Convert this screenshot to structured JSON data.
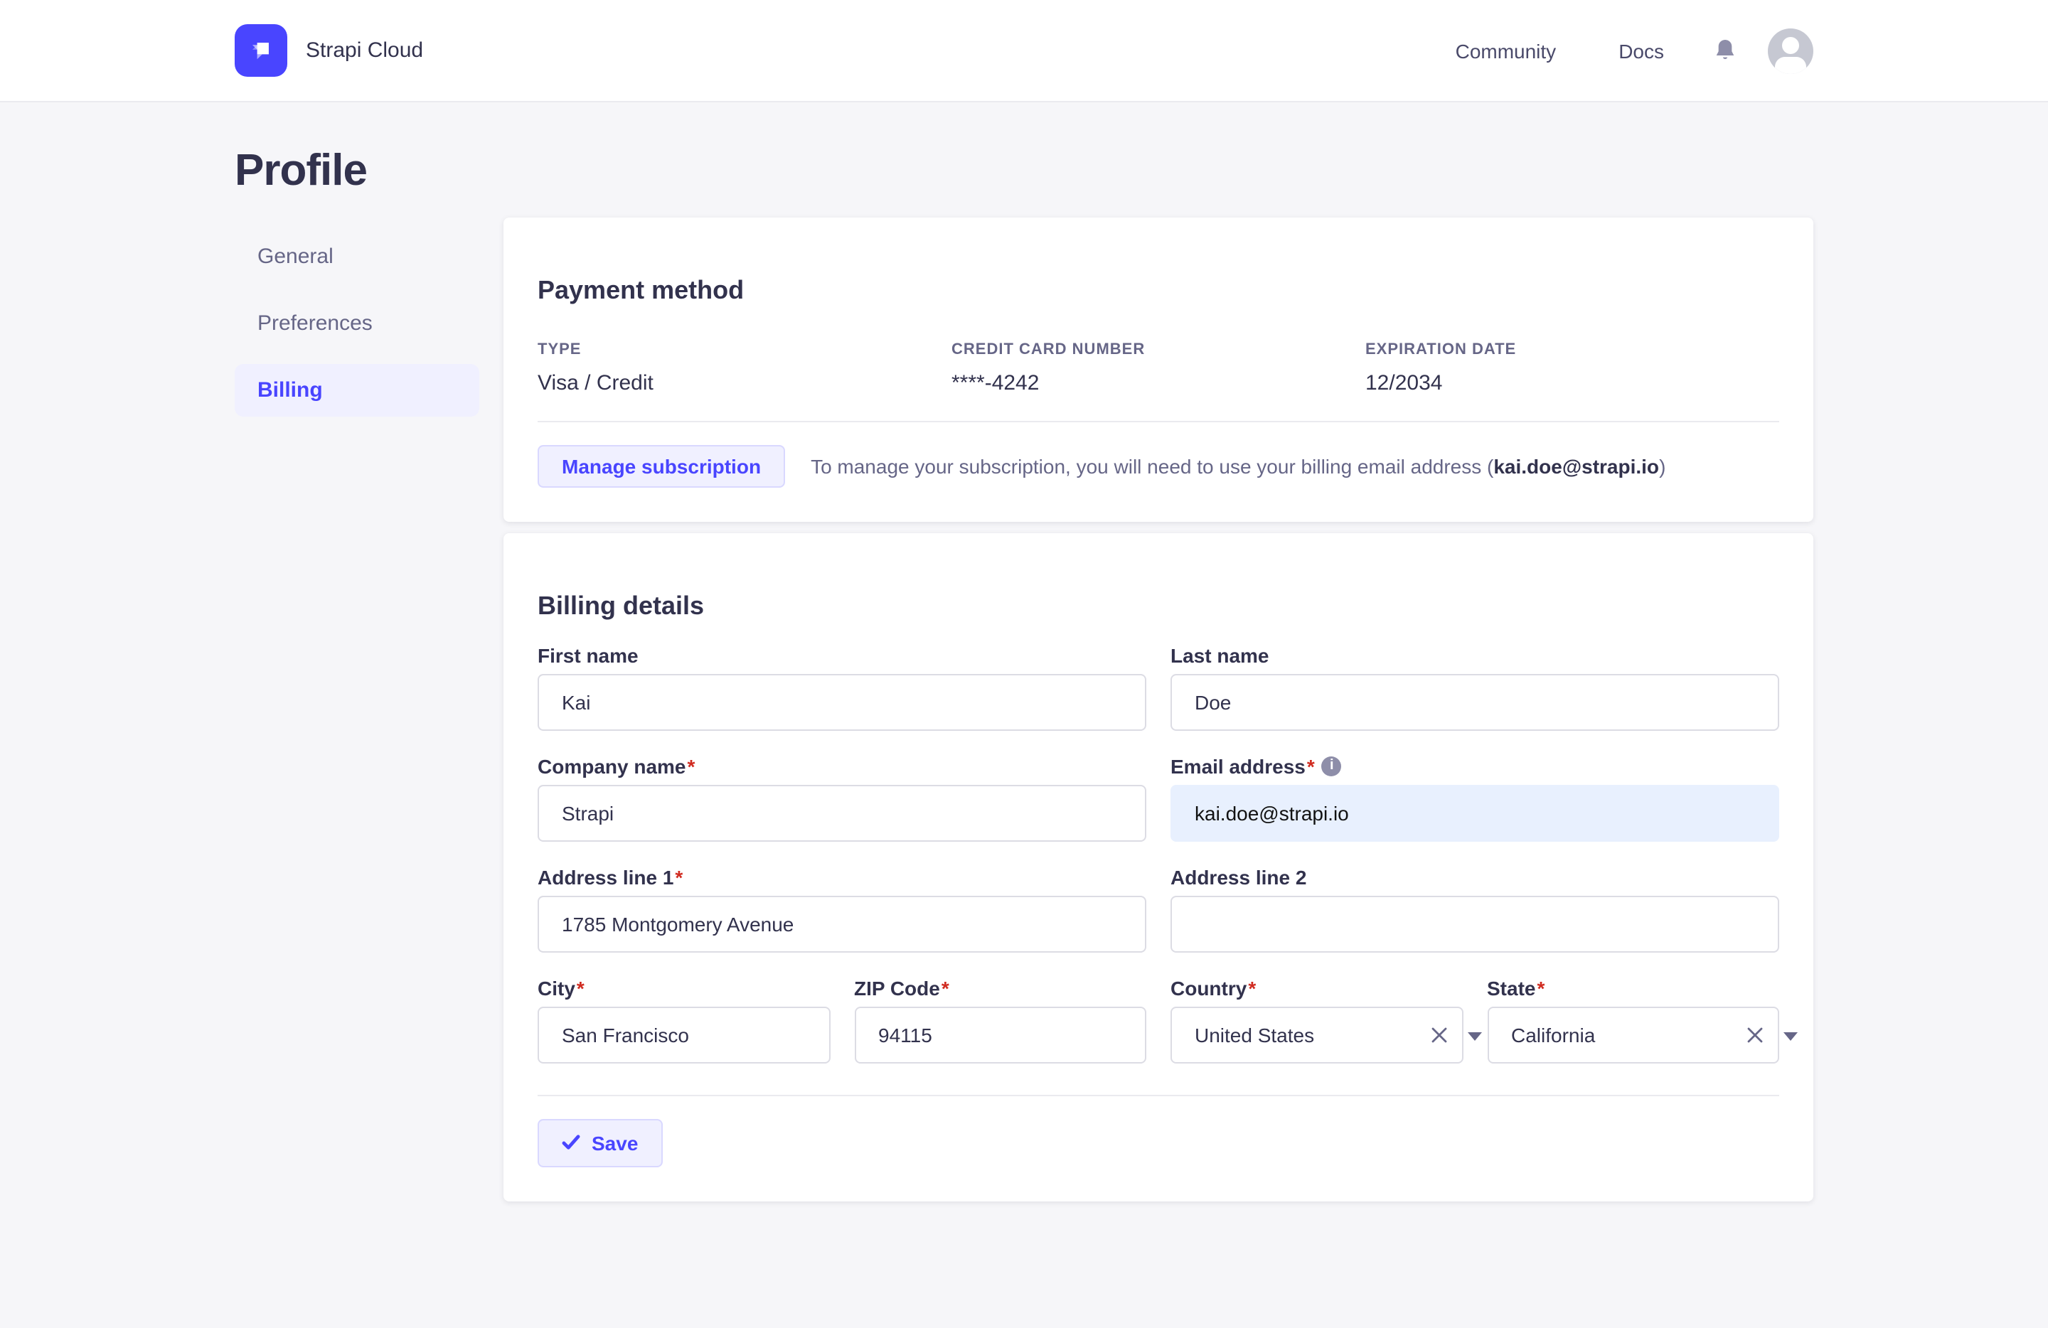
{
  "header": {
    "brand": "Strapi Cloud",
    "nav": [
      {
        "label": "Community"
      },
      {
        "label": "Docs"
      }
    ]
  },
  "page": {
    "title": "Profile"
  },
  "sidebar": {
    "items": [
      {
        "label": "General",
        "active": false
      },
      {
        "label": "Preferences",
        "active": false
      },
      {
        "label": "Billing",
        "active": true
      }
    ]
  },
  "payment": {
    "title": "Payment method",
    "columns": [
      {
        "label": "TYPE",
        "value": "Visa / Credit"
      },
      {
        "label": "CREDIT CARD NUMBER",
        "value": "****-4242"
      },
      {
        "label": "EXPIRATION DATE",
        "value": "12/2034"
      }
    ],
    "manage_button": "Manage subscription",
    "helper_prefix": "To manage your subscription, you will need to use your billing email address (",
    "helper_email": "kai.doe@strapi.io",
    "helper_suffix": ")"
  },
  "billing": {
    "title": "Billing details",
    "required_mark": "*",
    "info_icon_glyph": "i",
    "fields": {
      "first_name": {
        "label": "First name",
        "value": "Kai"
      },
      "last_name": {
        "label": "Last name",
        "value": "Doe"
      },
      "company": {
        "label": "Company name",
        "value": "Strapi"
      },
      "email": {
        "label": "Email address",
        "value": "kai.doe@strapi.io"
      },
      "address1": {
        "label": "Address line 1",
        "value": "1785 Montgomery Avenue"
      },
      "address2": {
        "label": "Address line 2",
        "value": ""
      },
      "city": {
        "label": "City",
        "value": "San Francisco"
      },
      "zip": {
        "label": "ZIP Code",
        "value": "94115"
      },
      "country": {
        "label": "Country",
        "value": "United States"
      },
      "state": {
        "label": "State",
        "value": "California"
      }
    },
    "save_label": "Save"
  },
  "colors": {
    "primary": "#4945ff",
    "primary_bg": "#f0f0ff",
    "primary_border": "#d9d8ff",
    "text_dark": "#32324d",
    "text_gray": "#666687",
    "input_border": "#dcdce4",
    "divider": "#eaeaef",
    "page_bg": "#f6f6f9",
    "danger": "#d02b20",
    "autofill_bg": "#e8f0fe"
  }
}
